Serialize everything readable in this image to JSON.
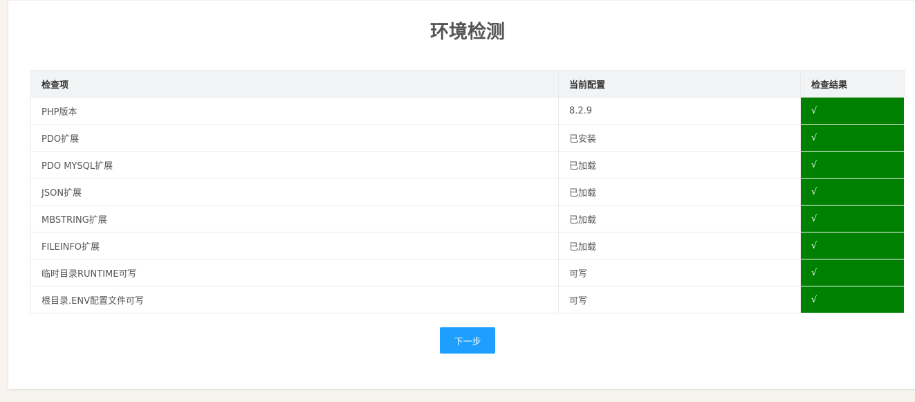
{
  "page": {
    "title": "环境检测"
  },
  "table": {
    "headers": {
      "item": "检查项",
      "config": "当前配置",
      "result": "检查结果"
    },
    "rows": [
      {
        "item": "PHP版本",
        "config": "8.2.9",
        "result": "√"
      },
      {
        "item": "PDO扩展",
        "config": "已安装",
        "result": "√"
      },
      {
        "item": "PDO MYSQL扩展",
        "config": "已加载",
        "result": "√"
      },
      {
        "item": "JSON扩展",
        "config": "已加载",
        "result": "√"
      },
      {
        "item": "MBSTRING扩展",
        "config": "已加载",
        "result": "√"
      },
      {
        "item": "FILEINFO扩展",
        "config": "已加载",
        "result": "√"
      },
      {
        "item": "临时目录RUNTIME可写",
        "config": "可写",
        "result": "√"
      },
      {
        "item": "根目录.ENV配置文件可写",
        "config": "可写",
        "result": "√"
      }
    ]
  },
  "actions": {
    "next_label": "下一步"
  },
  "colors": {
    "pass": "#008000",
    "primary_button": "#1e9fff",
    "header_bg": "#f2f3f5"
  }
}
